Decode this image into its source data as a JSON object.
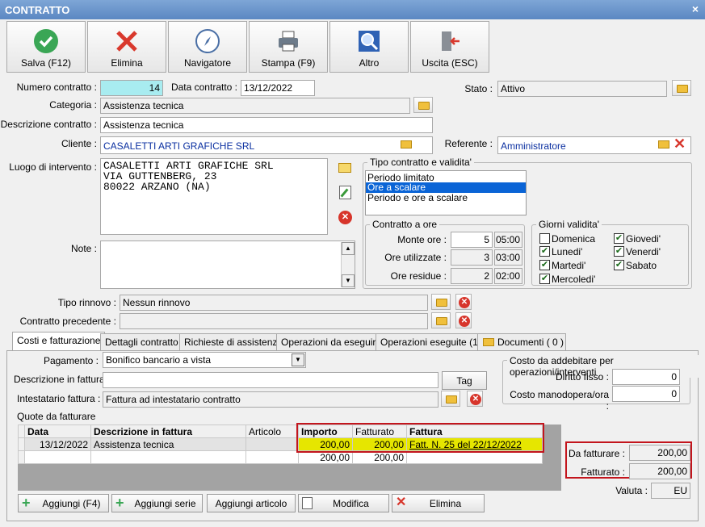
{
  "window": {
    "title": "CONTRATTO",
    "close": "×"
  },
  "toolbar": [
    {
      "label": "Salva (F12)",
      "icon": "check-icon"
    },
    {
      "label": "Elimina",
      "icon": "delete-x-icon"
    },
    {
      "label": "Navigatore",
      "icon": "compass-icon"
    },
    {
      "label": "Stampa (F9)",
      "icon": "printer-icon"
    },
    {
      "label": "Altro",
      "icon": "search-icon"
    },
    {
      "label": "Uscita (ESC)",
      "icon": "exit-door-icon"
    }
  ],
  "header": {
    "numero_label": "Numero contratto :",
    "numero": "14",
    "data_label": "Data contratto :",
    "data": "13/12/2022",
    "stato_label": "Stato :",
    "stato": "Attivo",
    "categoria_label": "Categoria :",
    "categoria": "Assistenza tecnica",
    "descrizione_label": "Descrizione contratto :",
    "descrizione": "Assistenza tecnica",
    "cliente_label": "Cliente :",
    "cliente": "CASALETTI ARTI GRAFICHE SRL",
    "referente_label": "Referente :",
    "referente": "Amministratore",
    "luogo_label": "Luogo di intervento :",
    "luogo_lines": [
      "CASALETTI ARTI GRAFICHE SRL",
      "VIA GUTTENBERG, 23",
      "80022 ARZANO (NA)"
    ],
    "note_label": "Note :",
    "rinnovo_label": "Tipo rinnovo :",
    "rinnovo": "Nessun rinnovo",
    "precedente_label": "Contratto precedente :",
    "precedente": ""
  },
  "tipo_contratto": {
    "title": "Tipo contratto e validita'",
    "options": [
      "Periodo limitato",
      "Ore a scalare",
      "Periodo e ore a scalare"
    ],
    "selected": "Ore a scalare"
  },
  "contratto_ore": {
    "title": "Contratto a ore",
    "monte_label": "Monte ore :",
    "monte": "5",
    "monte_time": "05:00",
    "utilizzate_label": "Ore utilizzate :",
    "utilizzate": "3",
    "utilizzate_time": "03:00",
    "residue_label": "Ore residue :",
    "residue": "2",
    "residue_time": "02:00"
  },
  "giorni": {
    "title": "Giorni validita'",
    "days": [
      {
        "label": "Domenica",
        "checked": false
      },
      {
        "label": "Lunedi'",
        "checked": true
      },
      {
        "label": "Martedi'",
        "checked": true
      },
      {
        "label": "Mercoledi'",
        "checked": true
      },
      {
        "label": "Giovedi'",
        "checked": true
      },
      {
        "label": "Venerdi'",
        "checked": true
      },
      {
        "label": "Sabato",
        "checked": true
      }
    ]
  },
  "tabs": [
    "Costi e fatturazione",
    "Dettagli contratto",
    "Richieste di assistenza",
    "Operazioni da eseguire",
    "Operazioni eseguite (1)",
    "Documenti ( 0 )"
  ],
  "billing": {
    "pagamento_label": "Pagamento :",
    "pagamento": "Bonifico bancario a vista",
    "desc_fattura_label": "Descrizione in fattura",
    "desc_fattura": "",
    "tag_button": "Tag",
    "intestatario_label": "Intestatario fattura :",
    "intestatario": "Fattura ad intestatario contratto",
    "costo_title": "Costo da addebitare per operazioni/interventi",
    "diritto_label": "Diritto fisso :",
    "diritto": "0",
    "manodopera_label": "Costo manodopera/ora :",
    "manodopera": "0",
    "quote_label": "Quote da fatturare"
  },
  "quote_table": {
    "columns": [
      "Data",
      "Descrizione in fattura",
      "Articolo",
      "Importo",
      "Fatturato",
      "Fattura"
    ],
    "rows": [
      {
        "data": "13/12/2022",
        "descrizione": "Assistenza tecnica",
        "articolo": "",
        "importo": "200,00",
        "fatturato": "200,00",
        "fattura": "Fatt. N. 25 del 22/12/2022"
      }
    ],
    "totals": {
      "importo": "200,00",
      "fatturato": "200,00"
    }
  },
  "summary": {
    "da_fatturare_label": "Da fatturare :",
    "da_fatturare": "200,00",
    "fatturato_label": "Fatturato :",
    "fatturato": "200,00",
    "valuta_label": "Valuta :",
    "valuta": "EU"
  },
  "bottom_buttons": [
    "Aggiungi (F4)",
    "Aggiungi serie",
    "Aggiungi articolo",
    "Modifica",
    "Elimina"
  ],
  "colors": {
    "highlight": "#e6e600",
    "selected": "#0a64d6",
    "numero_bg": "#a8ecf0",
    "red_box": "#c3151d"
  }
}
